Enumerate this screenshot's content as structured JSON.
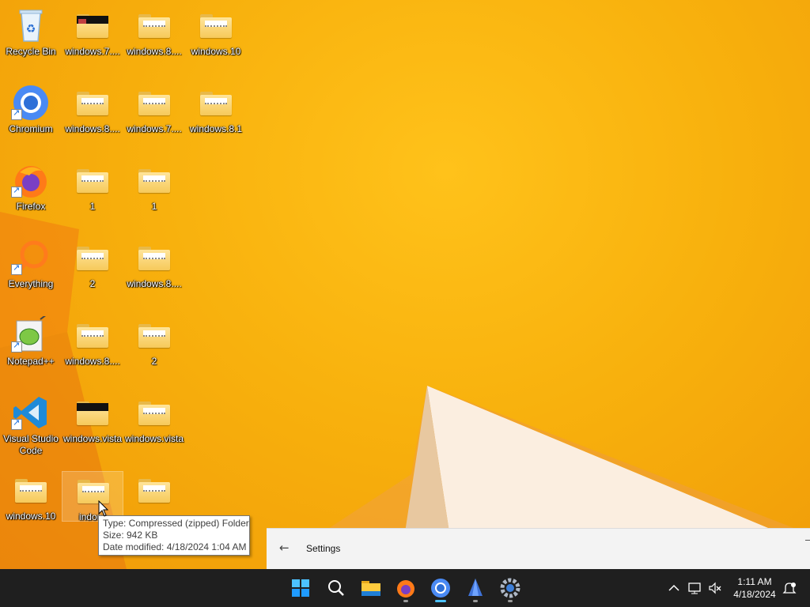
{
  "desktop": {
    "icons": [
      {
        "label": "Recycle Bin",
        "kind": "recycle-bin"
      },
      {
        "label": "windows.7....",
        "kind": "zip-black"
      },
      {
        "label": "windows.8....",
        "kind": "zip"
      },
      {
        "label": "windows.10",
        "kind": "zip"
      },
      {
        "label": "Chromium",
        "kind": "chromium"
      },
      {
        "label": "windows.8....",
        "kind": "zip"
      },
      {
        "label": "windows.7....",
        "kind": "zip"
      },
      {
        "label": "windows.8.1",
        "kind": "zip"
      },
      {
        "label": "Firefox",
        "kind": "firefox"
      },
      {
        "label": "1",
        "kind": "zip"
      },
      {
        "label": "1",
        "kind": "zip"
      },
      {
        "label": "Everything",
        "kind": "everything"
      },
      {
        "label": "2",
        "kind": "zip"
      },
      {
        "label": "windows.8....",
        "kind": "zip"
      },
      {
        "label": "Notepad++",
        "kind": "notepadpp"
      },
      {
        "label": "windows.8....",
        "kind": "zip"
      },
      {
        "label": "2",
        "kind": "zip"
      },
      {
        "label": "Visual Studio Code",
        "kind": "vscode"
      },
      {
        "label": "windows.vista",
        "kind": "zip-black"
      },
      {
        "label": "windows.vista",
        "kind": "zip"
      },
      {
        "label": "windows.10",
        "kind": "zip"
      },
      {
        "label": "indone",
        "kind": "zip"
      },
      {
        "label": "",
        "kind": "zip"
      }
    ]
  },
  "tooltip": {
    "type": "Type: Compressed (zipped) Folder",
    "size": "Size: 942 KB",
    "date": "Date modified: 4/18/2024 1:04 AM"
  },
  "settings_window": {
    "back_icon": "arrow-left-icon",
    "title": "Settings"
  },
  "taskbar": {
    "apps": [
      "start-icon",
      "search-icon",
      "file-explorer-icon",
      "firefox-icon",
      "chromium-icon",
      "app-icon",
      "settings-gear-icon"
    ],
    "tray": [
      "chevron-up-icon",
      "network-icon",
      "speaker-muted-icon"
    ],
    "time": "1:11 AM",
    "date": "4/18/2024",
    "notification_icon": "notification-icon"
  },
  "colors": {
    "wallpaper": "#f4ad0c",
    "taskbar": "#1f1f1f",
    "settings_bg": "#f3f3f3"
  }
}
